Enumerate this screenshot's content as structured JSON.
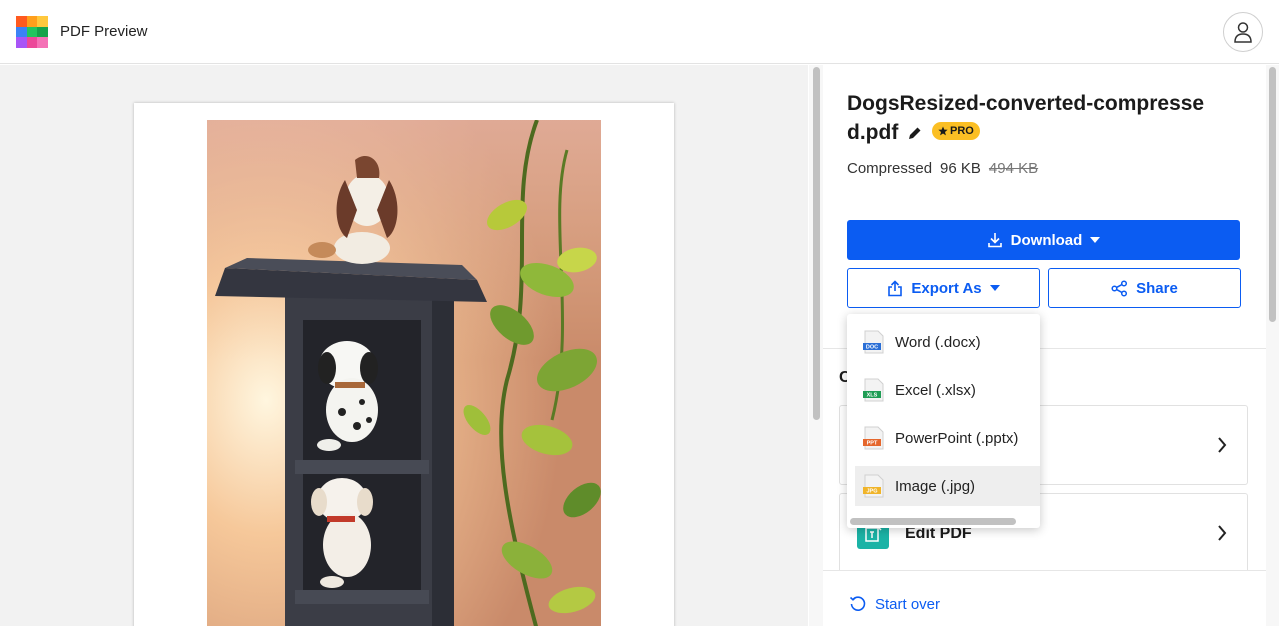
{
  "app": {
    "title": "PDF Preview",
    "logo_colors": [
      "#ff5a1f",
      "#ff9f1c",
      "#ffc83d",
      "#3b82f6",
      "#22c55e",
      "#16a34a",
      "#a855f7",
      "#ec4899",
      "#f472b6"
    ]
  },
  "file": {
    "name": "DogsResized-converted-compressed.pdf",
    "badge": "PRO",
    "status_label": "Compressed",
    "new_size": "96 KB",
    "old_size": "494 KB"
  },
  "actions": {
    "download_label": "Download",
    "export_label": "Export As",
    "share_label": "Share",
    "start_over_label": "Start over"
  },
  "section": {
    "heading_partial": "C",
    "cards": [
      {
        "label": "",
        "icon": "compress-icon"
      },
      {
        "label": "Edit PDF",
        "icon": "edit-pdf-icon"
      }
    ]
  },
  "export_menu": {
    "items": [
      {
        "label": "Word (.docx)",
        "tag": "DOC",
        "color": "#2b6fd6",
        "icon": "word-file-icon"
      },
      {
        "label": "Excel (.xlsx)",
        "tag": "XLS",
        "color": "#1f9d55",
        "icon": "excel-file-icon"
      },
      {
        "label": "PowerPoint (.pptx)",
        "tag": "PPT",
        "color": "#e5672d",
        "icon": "powerpoint-file-icon"
      },
      {
        "label": "Image (.jpg)",
        "tag": "JPG",
        "color": "#f0b429",
        "icon": "image-file-icon"
      }
    ]
  },
  "colors": {
    "primary": "#0b5cf2",
    "badge": "#fbbf24",
    "card_icon": "#1bb3a6"
  }
}
